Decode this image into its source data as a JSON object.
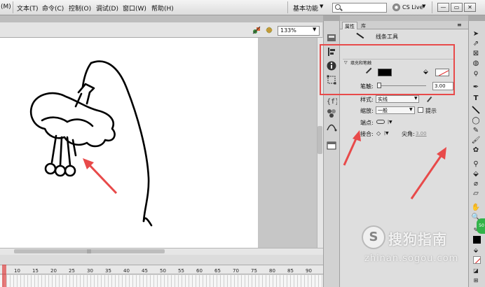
{
  "menubar": {
    "items": [
      "(M)",
      "文本(T)",
      "命令(C)",
      "控制(O)",
      "调试(D)",
      "窗口(W)",
      "帮助(H)"
    ],
    "workspace_label": "基本功能",
    "cs_live": "CS Live",
    "window_buttons": [
      "—",
      "▭",
      "✕"
    ]
  },
  "stage_toolbar": {
    "zoom": "133%"
  },
  "timeline": {
    "ticks": [
      "10",
      "15",
      "20",
      "25",
      "30",
      "35",
      "40",
      "45",
      "50",
      "55",
      "60",
      "65",
      "70",
      "75",
      "80",
      "85",
      "90"
    ]
  },
  "panel": {
    "tabs": [
      "属性",
      "库"
    ],
    "tool_name": "线条工具",
    "section_title": "填充和笔触",
    "stroke_width_label": "笔触:",
    "stroke_width_value": "3.00",
    "style_label": "样式:",
    "style_value": "实线",
    "scale_label": "缩放:",
    "scale_value": "一般",
    "hint_label": "提示",
    "cap_label": "端点:",
    "join_label": "接合:",
    "miter_label": "尖角:",
    "miter_value": "3.00",
    "colors": {
      "stroke": "#000000",
      "fill": "none"
    }
  },
  "watermark": {
    "logo": "S",
    "text": "搜狗指南",
    "url": "zhinan.sogou.com"
  },
  "annotation_color": "#e84a4a"
}
